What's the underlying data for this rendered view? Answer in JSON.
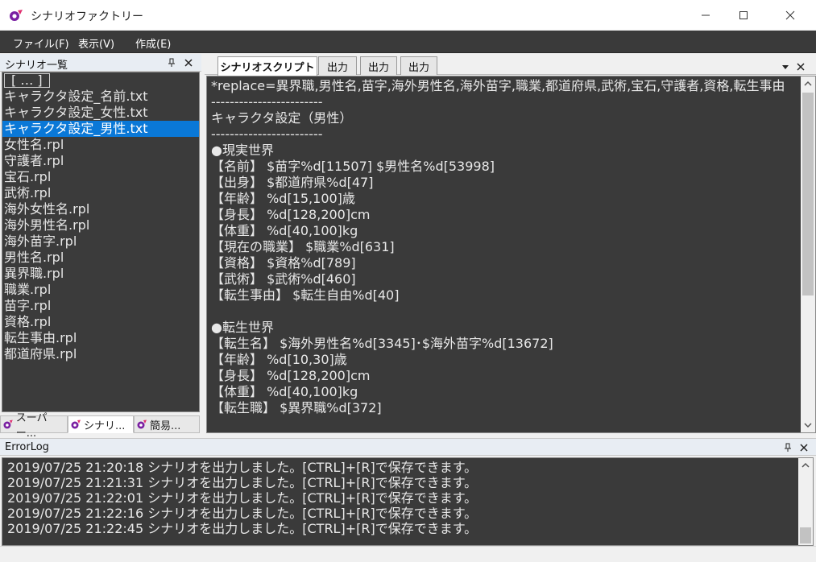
{
  "window": {
    "title": "シナリオファクトリー"
  },
  "menu": {
    "items": [
      "ファイル(F)",
      "表示(V)",
      "作成(E)"
    ]
  },
  "left_panel": {
    "title": "シナリオ一覧",
    "items": [
      "[ … ]",
      "キャラクタ設定_名前.txt",
      "キャラクタ設定_女性.txt",
      "キャラクタ設定_男性.txt",
      "女性名.rpl",
      "守護者.rpl",
      "宝石.rpl",
      "武術.rpl",
      "海外女性名.rpl",
      "海外男性名.rpl",
      "海外苗字.rpl",
      "男性名.rpl",
      "異界職.rpl",
      "職業.rpl",
      "苗字.rpl",
      "資格.rpl",
      "転生事由.rpl",
      "都道府県.rpl"
    ],
    "selected_index": 3,
    "bottom_tabs": [
      "スーパー...",
      "シナリ...",
      "簡易..."
    ]
  },
  "script_panel": {
    "tabs": [
      "シナリオスクリプト",
      "出力",
      "出力",
      "出力"
    ],
    "lines": [
      "*replace=異界職,男性名,苗字,海外男性名,海外苗字,職業,都道府県,武術,宝石,守護者,資格,転生事由",
      "------------------------",
      "キャラクタ設定（男性）",
      "------------------------",
      "●現実世界",
      "【名前】 $苗字%d[11507] $男性名%d[53998]",
      "【出身】 $都道府県%d[47]",
      "【年齢】 %d[15,100]歳",
      "【身長】 %d[128,200]cm",
      "【体重】 %d[40,100]kg",
      "【現在の職業】 $職業%d[631]",
      "【資格】 $資格%d[789]",
      "【武術】 $武術%d[460]",
      "【転生事由】 $転生自由%d[40]",
      "",
      "●転生世界",
      "【転生名】 $海外男性名%d[3345]･$海外苗字%d[13672]",
      "【年齢】 %d[10,30]歳",
      "【身長】 %d[128,200]cm",
      "【体重】 %d[40,100]kg",
      "【転生職】 $異界職%d[372]"
    ]
  },
  "errorlog": {
    "title": "ErrorLog",
    "lines": [
      "2019/07/25 21:20:18 シナリオを出力しました。[CTRL]+[R]で保存できます。",
      "2019/07/25 21:21:31 シナリオを出力しました。[CTRL]+[R]で保存できます。",
      "2019/07/25 21:22:01 シナリオを出力しました。[CTRL]+[R]で保存できます。",
      "2019/07/25 21:22:16 シナリオを出力しました。[CTRL]+[R]で保存できます。",
      "2019/07/25 21:22:45 シナリオを出力しました。[CTRL]+[R]で保存できます。"
    ]
  },
  "colors": {
    "accent": "#0a78d7",
    "editor_bg": "#3a3a3a",
    "editor_text": "#e8e8e8"
  },
  "icons": [
    "app-icon",
    "minimize-icon",
    "maximize-icon",
    "close-icon",
    "pin-icon",
    "dropdown-icon"
  ]
}
